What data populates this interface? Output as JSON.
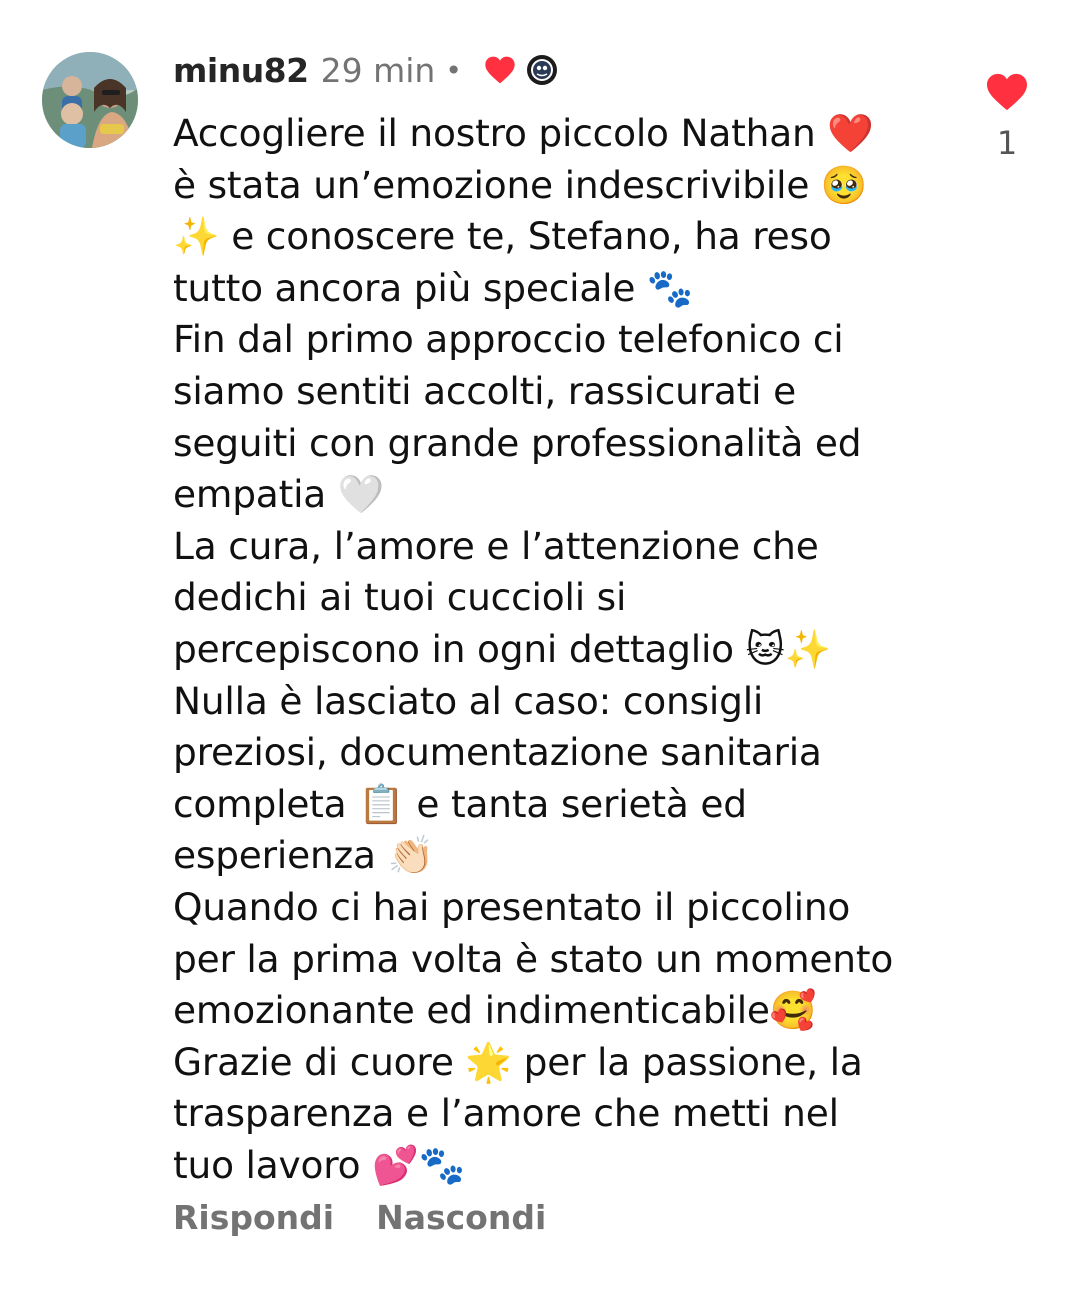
{
  "comment": {
    "username": "minu82",
    "time": "29 min",
    "separator": "•",
    "creator_liked_icon": "heart-icon",
    "body_lines": [
      "Accogliere il nostro piccolo Nathan ❤️",
      "è stata un’emozione indescrivibile 🥹",
      "✨ e conoscere te, Stefano, ha reso",
      "tutto ancora più speciale 🐾",
      "Fin dal primo approccio telefonico ci",
      "siamo sentiti accolti, rassicurati e",
      "seguiti con grande professionalità ed",
      "empatia 🤍",
      "La cura, l’amore e l’attenzione che",
      "dedichi ai tuoi cuccioli si",
      "percepiscono in ogni dettaglio 🐱✨",
      "Nulla è lasciato al caso: consigli",
      "preziosi, documentazione sanitaria",
      "completa 📋 e tanta serietà ed",
      "esperienza 👏🏻",
      "Quando ci hai presentato il piccolino",
      "per la prima volta è stato un momento",
      "emozionante ed indimenticabile🥰",
      "Grazie di cuore 🌟 per la passione, la",
      "trasparenza e l’amore che metti nel",
      "tuo lavoro 💕🐾"
    ],
    "like": {
      "icon": "heart-icon",
      "count": "1",
      "color": "#ff3040"
    },
    "actions": {
      "reply_label": "Rispondi",
      "hide_label": "Nascondi"
    }
  }
}
